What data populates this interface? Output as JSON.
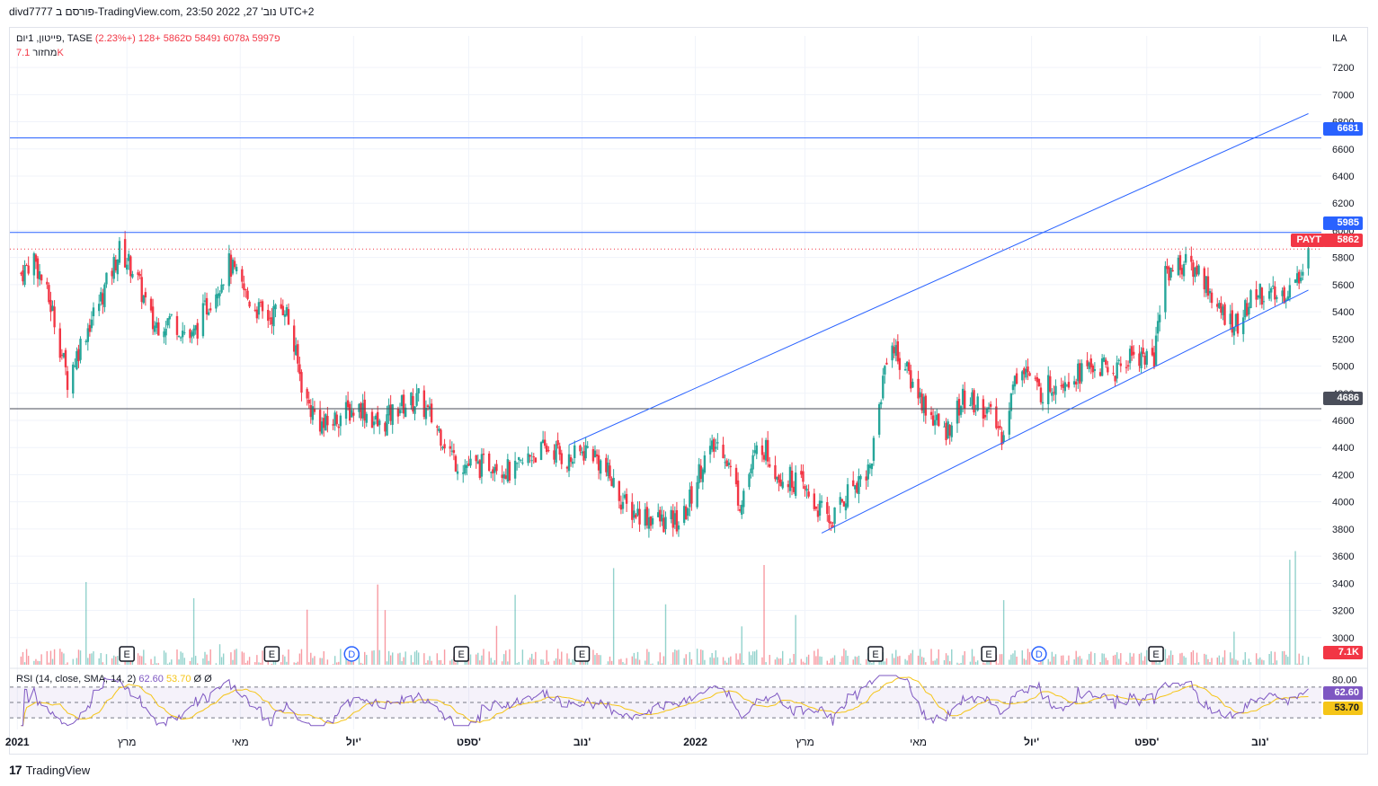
{
  "header": {
    "published_text": "divd7777 פורסם ב-TradingView.com, נוב' 27, 2022 23:50 UTC+2"
  },
  "legend": {
    "symbol_line": "פייטון, 1יום, TASE",
    "open": "פ5997",
    "high": "ג6078",
    "low": "נ5849",
    "close": "ס5862",
    "change": "+128 (+2.23%)",
    "volume_label": "מחזור",
    "volume_value": "7.1K"
  },
  "rsi_legend": {
    "label": "RSI (14, close, SMA, 14, 2)",
    "rsi_value": "62.60",
    "sma_value": "53.70",
    "extra1": "Ø",
    "extra2": "Ø"
  },
  "axis": {
    "currency": "ILA"
  },
  "badges": {
    "resistance_high": "6681",
    "resistance": "5985",
    "last_symbol": "PAYT",
    "last_price": "5862",
    "support": "4686",
    "volume": "7.1K",
    "rsi": "62.60",
    "rsi_sma": "53.70"
  },
  "footer": {
    "brand": "TradingView"
  },
  "colors": {
    "up": "#26a69a",
    "down": "#f23645",
    "line": "#2962ff",
    "rsi": "#7e57c2",
    "rsi_sma": "#f5c518",
    "grid": "#f0f3fa"
  },
  "chart_data": {
    "type": "candlestick",
    "title": "פייטון, 1יום, TASE",
    "y_axis": {
      "min": 2800,
      "max": 7300,
      "ticks": [
        3000,
        3200,
        3400,
        3600,
        3800,
        4000,
        4200,
        4400,
        4600,
        4800,
        5000,
        5200,
        5400,
        5600,
        5800,
        6000,
        6200,
        6400,
        6600,
        6800,
        7000,
        7200
      ],
      "unit": "ILA"
    },
    "x_axis": {
      "ticks": [
        "2021",
        "מרץ",
        "מאי",
        "יול'",
        "ספט'",
        "נוב'",
        "2022",
        "מרץ",
        "מאי",
        "יול'",
        "ספט'",
        "נוב'"
      ]
    },
    "close_path": [
      [
        "2021-01-01",
        5650
      ],
      [
        "2021-01-10",
        5800
      ],
      [
        "2021-01-20",
        5400
      ],
      [
        "2021-01-28",
        4900
      ],
      [
        "2021-02-05",
        5200
      ],
      [
        "2021-02-15",
        5500
      ],
      [
        "2021-02-25",
        5850
      ],
      [
        "2021-03-05",
        5700
      ],
      [
        "2021-03-15",
        5300
      ],
      [
        "2021-03-25",
        5350
      ],
      [
        "2021-04-05",
        5200
      ],
      [
        "2021-04-15",
        5500
      ],
      [
        "2021-04-25",
        5750
      ],
      [
        "2021-05-05",
        5500
      ],
      [
        "2021-05-15",
        5350
      ],
      [
        "2021-05-25",
        5450
      ],
      [
        "2021-06-05",
        4750
      ],
      [
        "2021-06-15",
        4550
      ],
      [
        "2021-06-25",
        4650
      ],
      [
        "2021-07-05",
        4700
      ],
      [
        "2021-07-15",
        4550
      ],
      [
        "2021-07-25",
        4700
      ],
      [
        "2021-08-05",
        4750
      ],
      [
        "2021-08-15",
        4550
      ],
      [
        "2021-08-25",
        4300
      ],
      [
        "2021-09-05",
        4250
      ],
      [
        "2021-09-15",
        4300
      ],
      [
        "2021-09-25",
        4200
      ],
      [
        "2021-10-05",
        4350
      ],
      [
        "2021-10-15",
        4400
      ],
      [
        "2021-10-25",
        4300
      ],
      [
        "2021-11-05",
        4400
      ],
      [
        "2021-11-15",
        4200
      ],
      [
        "2021-11-25",
        3950
      ],
      [
        "2021-12-05",
        3900
      ],
      [
        "2021-12-15",
        3850
      ],
      [
        "2021-12-25",
        3850
      ],
      [
        "2022-01-05",
        4300
      ],
      [
        "2022-01-15",
        4450
      ],
      [
        "2022-01-25",
        4000
      ],
      [
        "2022-02-05",
        4450
      ],
      [
        "2022-02-15",
        4200
      ],
      [
        "2022-02-25",
        4150
      ],
      [
        "2022-03-05",
        4000
      ],
      [
        "2022-03-15",
        3850
      ],
      [
        "2022-03-25",
        4100
      ],
      [
        "2022-04-05",
        4250
      ],
      [
        "2022-04-10",
        4700
      ],
      [
        "2022-04-15",
        5200
      ],
      [
        "2022-04-25",
        4950
      ],
      [
        "2022-05-05",
        4700
      ],
      [
        "2022-05-15",
        4500
      ],
      [
        "2022-05-25",
        4750
      ],
      [
        "2022-06-05",
        4700
      ],
      [
        "2022-06-15",
        4500
      ],
      [
        "2022-06-25",
        5050
      ],
      [
        "2022-07-05",
        4800
      ],
      [
        "2022-07-15",
        4900
      ],
      [
        "2022-07-25",
        4950
      ],
      [
        "2022-08-05",
        5000
      ],
      [
        "2022-08-15",
        4950
      ],
      [
        "2022-08-25",
        5100
      ],
      [
        "2022-09-05",
        5050
      ],
      [
        "2022-09-10",
        5700
      ],
      [
        "2022-09-20",
        5750
      ],
      [
        "2022-09-30",
        5700
      ],
      [
        "2022-10-10",
        5400
      ],
      [
        "2022-10-20",
        5300
      ],
      [
        "2022-10-30",
        5550
      ],
      [
        "2022-11-10",
        5500
      ],
      [
        "2022-11-20",
        5600
      ],
      [
        "2022-11-27",
        5862
      ]
    ],
    "horizontal_lines": [
      6681,
      5985,
      4686
    ],
    "last_price_line": 5862,
    "channel_upper": [
      [
        "2021-10-25",
        4420
      ],
      [
        "2022-11-27",
        6860
      ]
    ],
    "channel_lower": [
      [
        "2022-03-10",
        3770
      ],
      [
        "2022-11-27",
        5560
      ]
    ],
    "event_markers": [
      {
        "type": "E",
        "date": "2021-03-01"
      },
      {
        "type": "E",
        "date": "2021-05-18"
      },
      {
        "type": "D",
        "date": "2021-06-30"
      },
      {
        "type": "E",
        "date": "2021-08-28"
      },
      {
        "type": "E",
        "date": "2021-11-01"
      },
      {
        "type": "E",
        "date": "2022-04-08"
      },
      {
        "type": "E",
        "date": "2022-06-08"
      },
      {
        "type": "D",
        "date": "2022-07-05"
      },
      {
        "type": "E",
        "date": "2022-09-06"
      }
    ],
    "rsi": {
      "length": 14,
      "sma_length": 14,
      "upper": 70,
      "lower": 30,
      "last_rsi": 62.6,
      "last_sma": 53.7
    }
  }
}
